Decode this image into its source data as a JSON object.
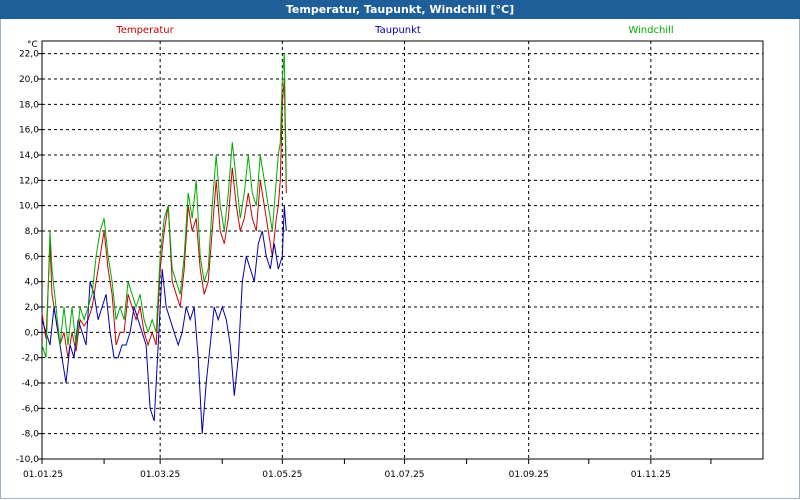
{
  "window": {
    "title": "Temperatur, Taupunkt, Windchill [°C]"
  },
  "chart_data": {
    "type": "line",
    "title": "Temperatur, Taupunkt, Windchill [°C]",
    "ylabel": "°C",
    "ylim": [
      -10,
      23
    ],
    "xlim": [
      0,
      360
    ],
    "grid": true,
    "legend_position": "top",
    "yticks": [
      "-10,0",
      "-8,0",
      "-6,0",
      "-4,0",
      "-2,0",
      "0,0",
      "2,0",
      "4,0",
      "6,0",
      "8,0",
      "10,0",
      "12,0",
      "14,0",
      "16,0",
      "18,0",
      "20,0",
      "22,0"
    ],
    "ytick_values": [
      -10,
      -8,
      -6,
      -4,
      -2,
      0,
      2,
      4,
      6,
      8,
      10,
      12,
      14,
      16,
      18,
      20,
      22
    ],
    "xticks": [
      "01.01.25",
      "01.03.25",
      "01.05.25",
      "01.07.25",
      "01.09.25",
      "01.11.25"
    ],
    "xtick_days": [
      0,
      59,
      120,
      181,
      243,
      304
    ],
    "series": [
      {
        "name": "Temperatur",
        "color": "#cc0000",
        "x": [
          0,
          2,
          4,
          5,
          7,
          9,
          11,
          13,
          15,
          17,
          19,
          21,
          23,
          25,
          27,
          29,
          31,
          33,
          35,
          37,
          39,
          41,
          43,
          45,
          47,
          49,
          51,
          53,
          55,
          57,
          59,
          61,
          63,
          65,
          67,
          69,
          71,
          73,
          75,
          77,
          79,
          81,
          83,
          85,
          87,
          89,
          91,
          93,
          95,
          97,
          99,
          101,
          103,
          105,
          107,
          109,
          111,
          113,
          115,
          117,
          118,
          119,
          120,
          121,
          122
        ],
        "y": [
          1.5,
          -0.5,
          7,
          3,
          1,
          -1,
          0,
          -2,
          0,
          -1.5,
          1,
          0.5,
          1,
          2,
          4,
          6,
          8,
          5,
          3,
          -1,
          0,
          0,
          3,
          2,
          1,
          2,
          0,
          -1,
          0,
          -1,
          5,
          8,
          10,
          4,
          3,
          2,
          5,
          10,
          8,
          9,
          5,
          3,
          4,
          8,
          12,
          8,
          7,
          9,
          13,
          10,
          8,
          9,
          11,
          9,
          8,
          12,
          10,
          8,
          6,
          9,
          10,
          12,
          18,
          20,
          11
        ]
      },
      {
        "name": "Taupunkt",
        "color": "#0000aa",
        "x": [
          0,
          2,
          4,
          6,
          8,
          10,
          12,
          14,
          16,
          18,
          20,
          22,
          24,
          26,
          28,
          30,
          32,
          34,
          36,
          38,
          40,
          42,
          44,
          46,
          48,
          50,
          52,
          54,
          56,
          58,
          60,
          62,
          64,
          66,
          68,
          70,
          72,
          74,
          76,
          78,
          80,
          82,
          84,
          86,
          88,
          90,
          92,
          94,
          96,
          98,
          100,
          102,
          104,
          106,
          108,
          110,
          112,
          114,
          116,
          118,
          120,
          121,
          122
        ],
        "y": [
          1,
          0,
          -1,
          2,
          0,
          -2,
          -4,
          -1,
          -2,
          1,
          0,
          -1,
          4,
          3,
          1,
          2,
          3,
          0,
          -2,
          -2,
          -1,
          -1,
          0,
          2,
          1,
          0,
          -1,
          -6,
          -7,
          -1,
          5,
          2,
          1,
          0,
          -1,
          0,
          2,
          1,
          2,
          -2,
          -8,
          -4,
          -1,
          2,
          1,
          2,
          1,
          -1,
          -5,
          -2,
          4,
          6,
          5,
          4,
          7,
          8,
          6,
          5,
          7,
          5,
          6,
          10,
          8
        ]
      },
      {
        "name": "Windchill",
        "color": "#00aa00",
        "x": [
          0,
          2,
          4,
          5,
          7,
          9,
          11,
          13,
          15,
          17,
          19,
          21,
          23,
          25,
          27,
          29,
          31,
          33,
          35,
          37,
          39,
          41,
          43,
          45,
          47,
          49,
          51,
          53,
          55,
          57,
          59,
          61,
          63,
          65,
          67,
          69,
          71,
          73,
          75,
          77,
          79,
          81,
          83,
          85,
          87,
          89,
          91,
          93,
          95,
          97,
          99,
          101,
          103,
          105,
          107,
          109,
          111,
          113,
          115,
          117,
          118,
          119,
          120,
          121,
          122
        ],
        "y": [
          -1,
          -2,
          8,
          5,
          2,
          -1,
          2,
          -1,
          2,
          -1,
          2,
          1,
          2,
          3,
          6,
          8,
          9,
          6,
          4,
          1,
          2,
          1,
          4,
          3,
          2,
          3,
          1,
          0,
          1,
          0,
          6,
          9,
          10,
          5,
          4,
          3,
          6,
          11,
          9,
          12,
          6,
          4,
          5,
          10,
          14,
          10,
          8,
          11,
          15,
          12,
          9,
          11,
          14,
          11,
          10,
          14,
          12,
          10,
          8,
          12,
          14,
          15,
          20,
          22,
          12
        ]
      }
    ]
  }
}
